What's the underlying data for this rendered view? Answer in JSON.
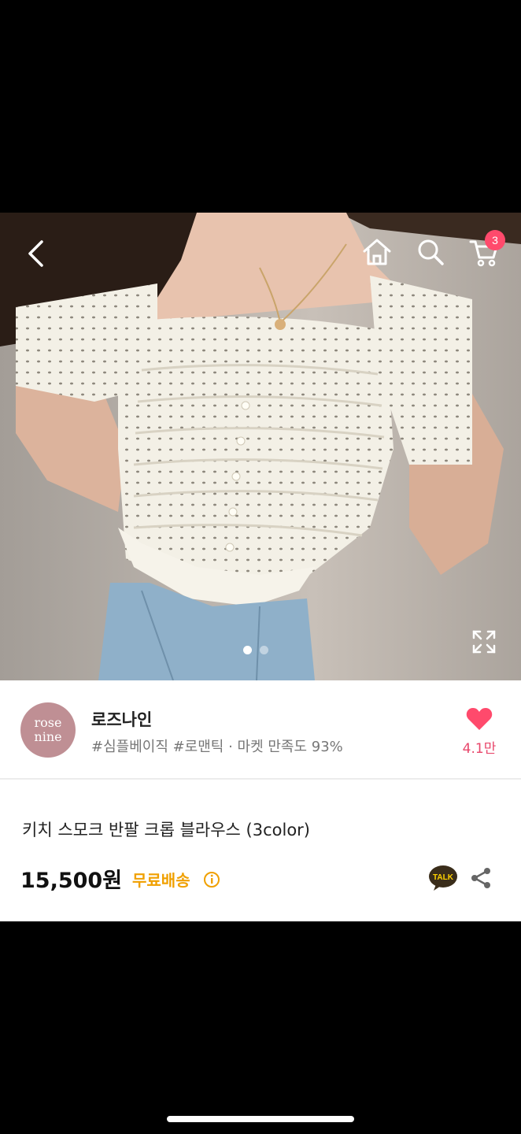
{
  "header": {
    "back_icon": "chevron-left-icon",
    "home_icon": "home-icon",
    "search_icon": "search-icon",
    "cart_icon": "cart-icon",
    "cart_badge": "3"
  },
  "gallery": {
    "image_alt": "product photo",
    "page_count": 2,
    "active_index": 0,
    "expand_icon": "expand-icon"
  },
  "shop": {
    "logo_line1": "rose",
    "logo_line2": "nine",
    "name": "로즈나인",
    "tags": "#심플베이직 #로맨틱 · 마켓 만족도 93%",
    "like_icon": "heart-icon",
    "like_count": "4.1만"
  },
  "product": {
    "title": "키치 스모크 반팔 크롭 블라우스 (3color)",
    "price": "15,500원",
    "shipping": "무료배송",
    "talk_label": "TALK",
    "share_icon": "share-icon"
  },
  "colors": {
    "accent": "#ff4a6c",
    "shipping": "#f0a000",
    "logo_bg": "#bf8f94",
    "talk_bg": "#3a2d1a",
    "talk_bubble": "#ffd200"
  }
}
